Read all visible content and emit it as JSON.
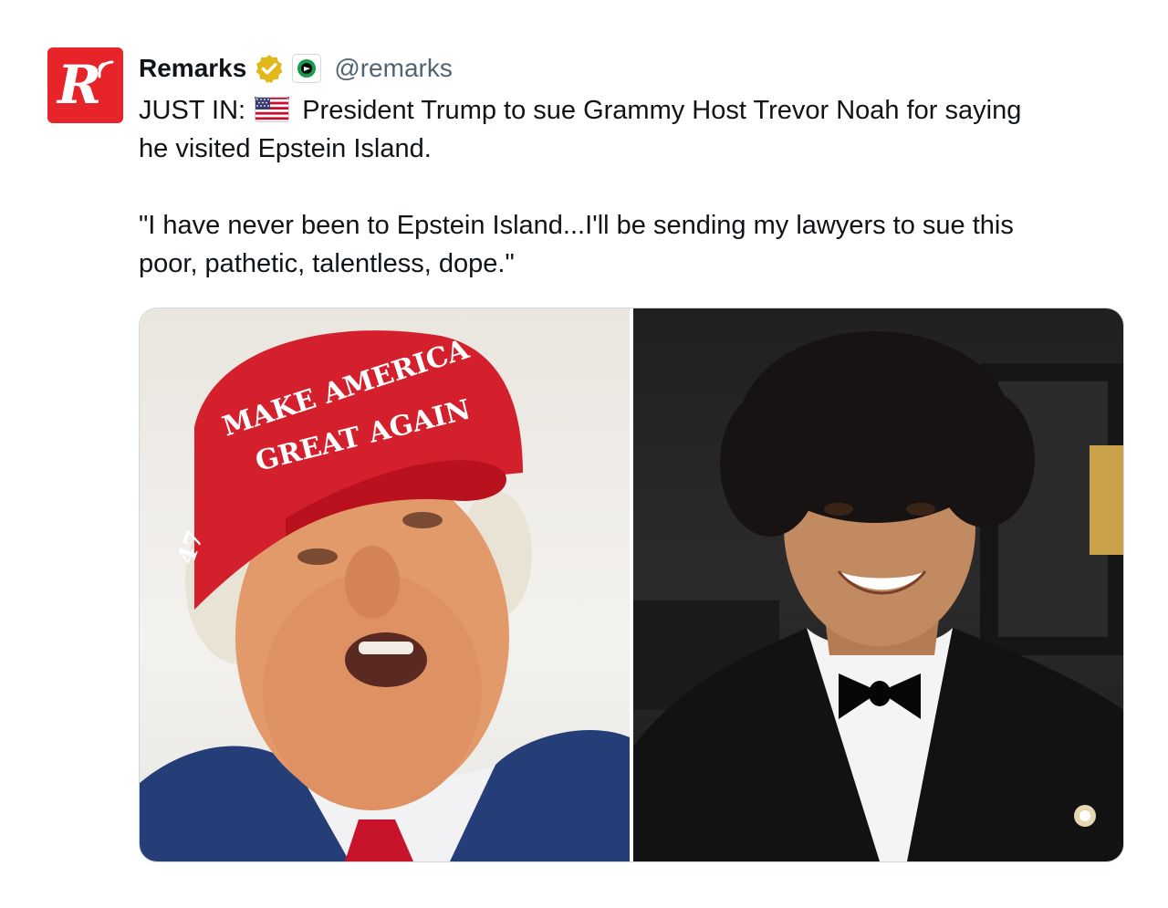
{
  "post": {
    "display_name": "Remarks",
    "handle": "@remarks",
    "avatar_letter": "R",
    "text_lines": [
      "President Trump to sue Grammy Host Trevor Noah for saying",
      "he visited Epstein Island.",
      "\"I have never been to Epstein Island...I'll be sending my lawyers to sue this",
      "poor, pathetic, talentless, dope.\""
    ],
    "text_prefix": "JUST IN:",
    "flag_icon": "us-flag-icon",
    "verified_icon": "gold-verified-badge-icon",
    "affiliate_icon": "affiliate-badge-icon"
  },
  "media": {
    "left_photo": {
      "cap_text_line1": "MAKE AMERICA",
      "cap_text_line2": "GREAT AGAIN",
      "cap_side_text": "47"
    },
    "right_photo": {}
  },
  "colors": {
    "brand_red": "#e6242a",
    "verified_gold": "#e2b719",
    "handle_gray": "#536471"
  }
}
